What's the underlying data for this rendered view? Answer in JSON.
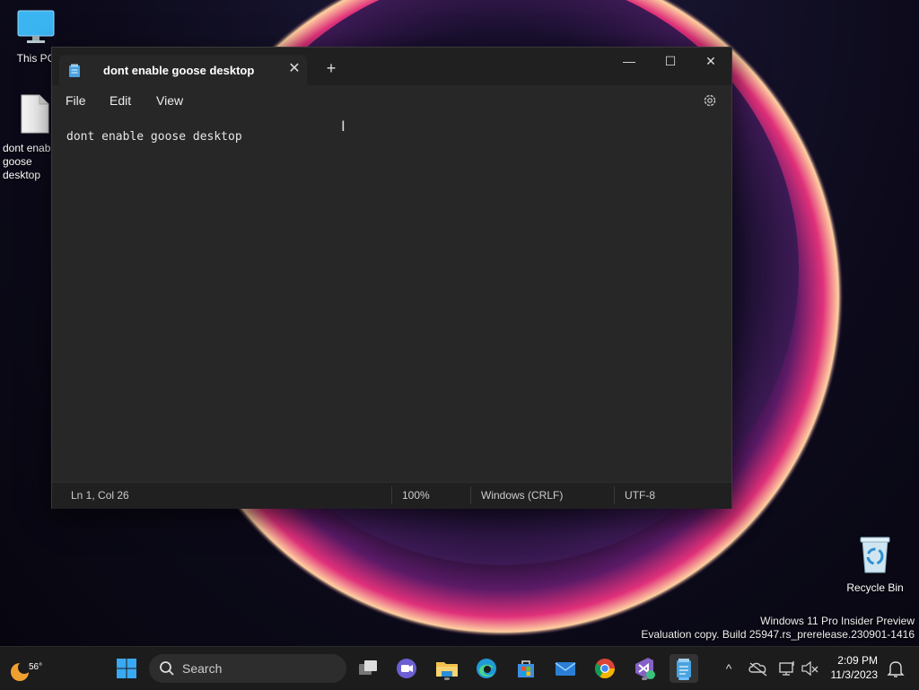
{
  "desktop": {
    "icons": [
      {
        "label": "This PC"
      },
      {
        "label": "dont enable goose desktop"
      },
      {
        "label": "Recycle Bin"
      }
    ],
    "watermark": {
      "line1": "Windows 11 Pro Insider Preview",
      "line2": "Evaluation copy. Build 25947.rs_prerelease.230901-1416"
    }
  },
  "notepad": {
    "tab_title": "dont enable goose desktop",
    "tab_close": "✕",
    "new_tab": "+",
    "window_controls": {
      "minimize": "—",
      "maximize": "☐",
      "close": "✕"
    },
    "menu": [
      "File",
      "Edit",
      "View"
    ],
    "content": "dont enable goose desktop",
    "status": {
      "position": "Ln 1, Col 26",
      "zoom": "100%",
      "line_ending": "Windows (CRLF)",
      "encoding": "UTF-8"
    }
  },
  "taskbar": {
    "weather_temp": "56°",
    "search_label": "Search",
    "chevron": "^",
    "time": "2:09 PM",
    "date": "11/3/2023"
  }
}
